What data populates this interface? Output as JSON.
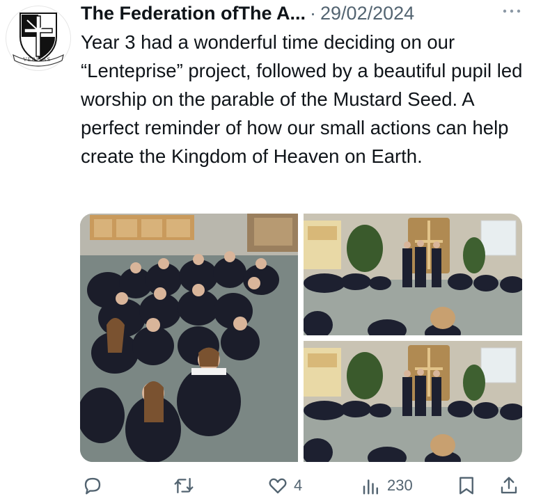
{
  "tweet": {
    "author": "The Federation ofThe A...",
    "separator": "·",
    "date": "29/02/2024",
    "more_icon": "more-horizontal-icon",
    "avatar_text": "VERITAS",
    "text": "Year 3 had a wonderful time deciding on our “Lenteprise” project, followed by a beautiful pupil led worship on the parable of the Mustard Seed. A perfect reminder of how our small actions can help create the Kingdom of Heaven on Earth."
  },
  "media": {
    "photo_count": 3,
    "photos": [
      "pupils-sitting-on-floor-photo",
      "pupils-worship-circle-photo-1",
      "pupils-worship-circle-photo-2"
    ]
  },
  "actions": {
    "reply": {
      "icon": "reply-icon",
      "count": ""
    },
    "retweet": {
      "icon": "retweet-icon",
      "count": ""
    },
    "like": {
      "icon": "heart-icon",
      "count": "4"
    },
    "views": {
      "icon": "views-chart-icon",
      "count": "230"
    },
    "bookmark": {
      "icon": "bookmark-icon"
    },
    "share": {
      "icon": "share-icon"
    }
  },
  "colors": {
    "text": "#0f1419",
    "secondary": "#536471",
    "background": "#ffffff"
  }
}
